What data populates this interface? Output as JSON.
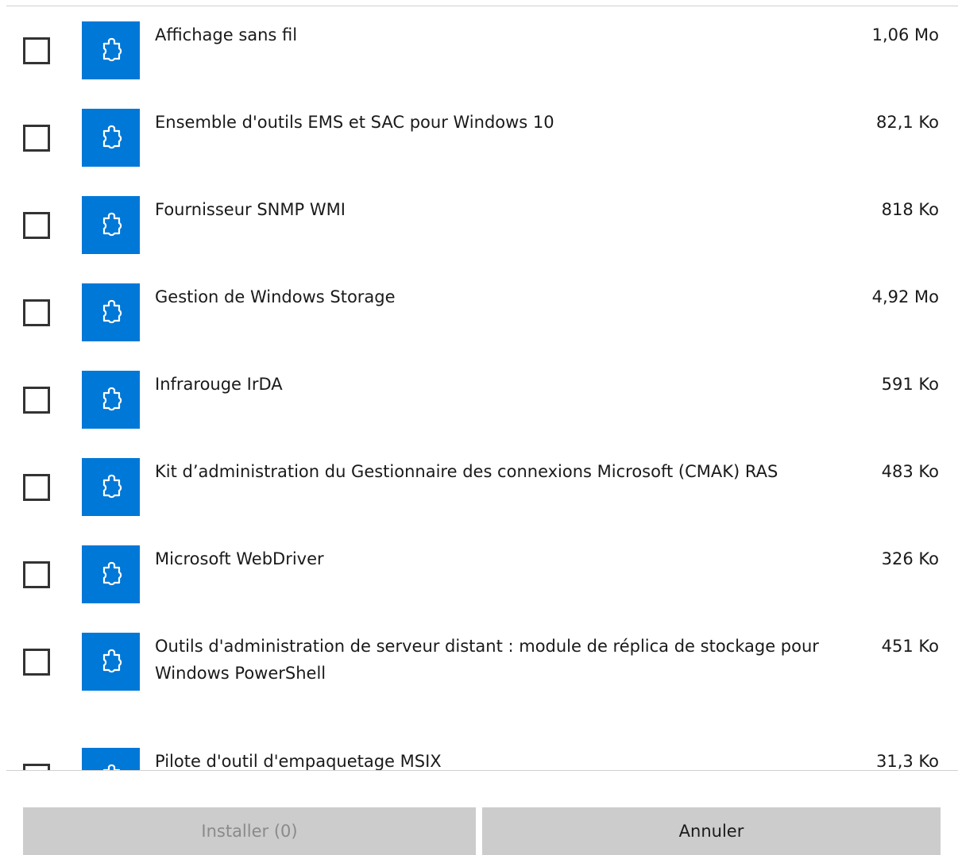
{
  "features": [
    {
      "name": "Affichage sans fil",
      "size": "1,06 Mo"
    },
    {
      "name": "Ensemble d'outils EMS et SAC pour Windows 10",
      "size": "82,1 Ko"
    },
    {
      "name": "Fournisseur SNMP WMI",
      "size": "818 Ko"
    },
    {
      "name": "Gestion de Windows Storage",
      "size": "4,92 Mo"
    },
    {
      "name": "Infrarouge IrDA",
      "size": "591 Ko"
    },
    {
      "name": "Kit d’administration du Gestionnaire des connexions Microsoft (CMAK) RAS",
      "size": "483 Ko"
    },
    {
      "name": "Microsoft WebDriver",
      "size": "326 Ko"
    },
    {
      "name": "Outils d'administration de serveur distant : module de réplica de stockage pour Windows PowerShell",
      "size": "451 Ko"
    },
    {
      "name": "Pilote d'outil d'empaquetage MSIX",
      "size": "31,3 Ko"
    }
  ],
  "checkbox_states": [
    false,
    false,
    false,
    false,
    false,
    false,
    false,
    false,
    false
  ],
  "icon": "puzzle-piece-icon",
  "colors": {
    "accent": "#0078d7",
    "button_bg": "#cccccc",
    "disabled_text": "#8a8a8a"
  },
  "buttons": {
    "install_label": "Installer (0)",
    "cancel_label": "Annuler"
  }
}
